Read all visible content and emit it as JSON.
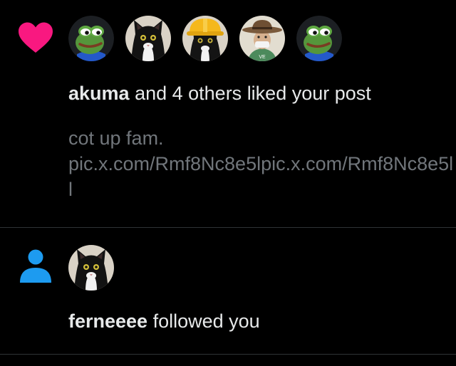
{
  "notifications": [
    {
      "type": "like",
      "type_icon": "heart-icon",
      "icon_color": "#f91880",
      "avatars": [
        {
          "icon": "pepe-frog-avatar"
        },
        {
          "icon": "black-cat-avatar"
        },
        {
          "icon": "cat-hardhat-avatar"
        },
        {
          "icon": "cowboy-hat-avatar"
        },
        {
          "icon": "pepe-frog-avatar"
        }
      ],
      "actor": "akuma",
      "action": "and 4 others liked your post",
      "preview_lines": [
        "cot up fam.",
        "pic.x.com/Rmf8Nc8e5lpic.x.com/Rmf8Nc8e5l",
        "l"
      ]
    },
    {
      "type": "follow",
      "type_icon": "person-icon",
      "icon_color": "#1d9bf0",
      "avatars": [
        {
          "icon": "black-cat-avatar"
        }
      ],
      "actor": "ferneeee",
      "action": "followed you"
    }
  ]
}
